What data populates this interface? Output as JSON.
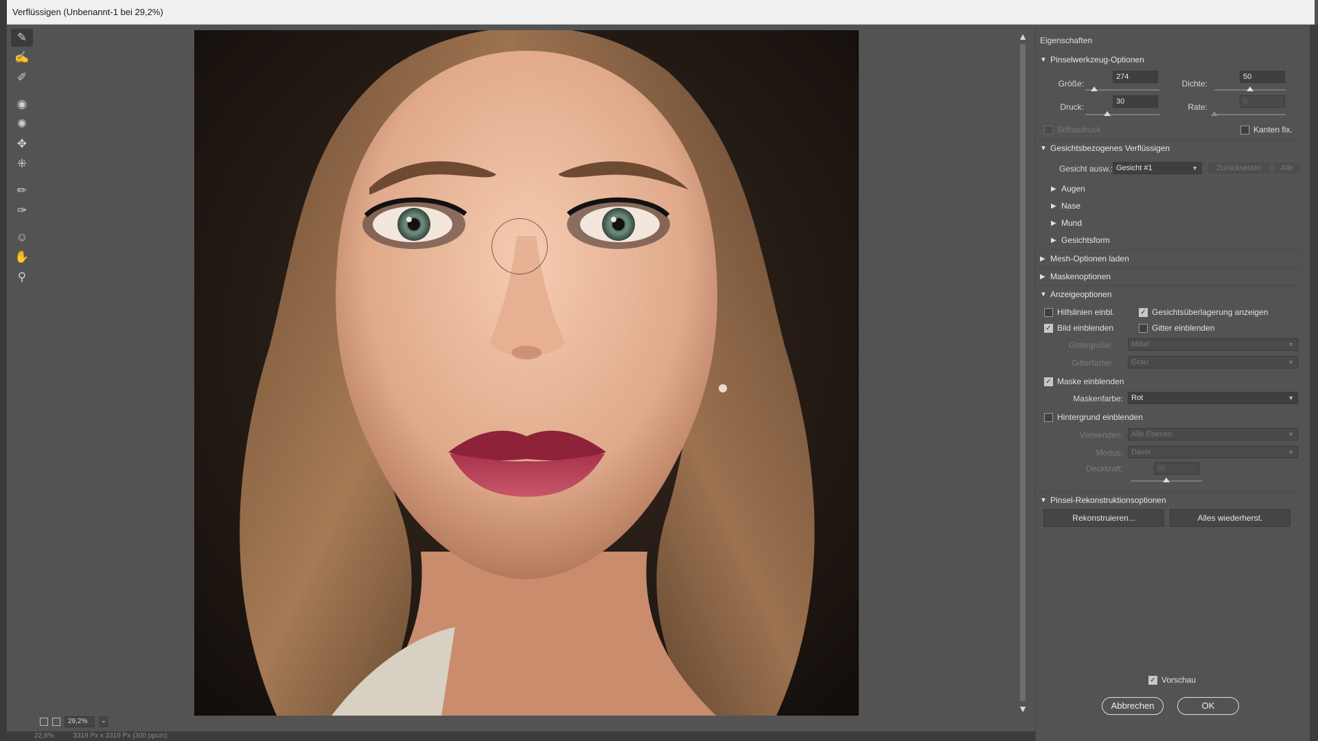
{
  "window": {
    "title": "Verflüssigen (Unbenannt-1 bei 29,2%)"
  },
  "tools": [
    {
      "name": "forward-warp-tool-icon",
      "glyph": "✎"
    },
    {
      "name": "reconstruct-tool-icon",
      "glyph": "✍"
    },
    {
      "name": "smooth-tool-icon",
      "glyph": "✐"
    },
    {
      "name": "twirl-tool-icon",
      "glyph": "◉"
    },
    {
      "name": "pucker-tool-icon",
      "glyph": "✺"
    },
    {
      "name": "bloat-tool-icon",
      "glyph": "✥"
    },
    {
      "name": "push-left-tool-icon",
      "glyph": "⁜"
    },
    {
      "name": "freeze-mask-tool-icon",
      "glyph": "✏"
    },
    {
      "name": "thaw-mask-tool-icon",
      "glyph": "✑"
    },
    {
      "name": "face-tool-icon",
      "glyph": "☺"
    },
    {
      "name": "hand-tool-icon",
      "glyph": "✋"
    },
    {
      "name": "zoom-tool-icon",
      "glyph": "⚲"
    }
  ],
  "canvas": {
    "zoom": "29,2%"
  },
  "status": {
    "zoom": "22,9%",
    "size": "3319 Px x 3319 Px (300 ppcm)"
  },
  "panel": {
    "title": "Eigenschaften",
    "brush": {
      "header": "Pinselwerkzeug-Optionen",
      "size_label": "Größe:",
      "size": "274",
      "size_fraction": 0.12,
      "density_label": "Dichte:",
      "density": "50",
      "density_fraction": 0.5,
      "pressure_label": "Druck:",
      "pressure": "30",
      "pressure_fraction": 0.3,
      "rate_label": "Rate:",
      "rate": "0",
      "rate_fraction": 0.0,
      "stylus_label": "Stiftandruck",
      "pin_edges_label": "Kanten fix."
    },
    "face": {
      "header": "Gesichtsbezogenes Verflüssigen",
      "select_label": "Gesicht ausw.:",
      "select_value": "Gesicht #1",
      "reset_label": "Zurücksetzen",
      "all_label": "Alle",
      "sub": [
        "Augen",
        "Nase",
        "Mund",
        "Gesichtsform"
      ]
    },
    "mesh_header": "Mesh-Optionen laden",
    "mask_header": "Maskenoptionen",
    "view": {
      "header": "Anzeigeoptionen",
      "guides_label": "Hilfslinien einbl.",
      "face_overlay_label": "Gesichtsüberlagerung anzeigen",
      "image_label": "Bild einblenden",
      "grid_label": "Gitter einblenden",
      "grid_size_label": "Gittergröße:",
      "grid_size_value": "Mittel",
      "grid_color_label": "Gitterfarbe:",
      "grid_color_value": "Grau",
      "mask_label": "Maske einblenden",
      "mask_color_label": "Maskenfarbe:",
      "mask_color_value": "Rot",
      "backdrop_label": "Hintergrund einblenden",
      "use_label": "Verwenden:",
      "use_value": "Alle Ebenen",
      "mode_label": "Modus:",
      "mode_value": "Davor",
      "opacity_label": "Deckkraft:",
      "opacity_value": "50",
      "opacity_fraction": 0.5
    },
    "reconstruct": {
      "header": "Pinsel-Rekonstruktionsoptionen",
      "reconstruct_label": "Rekonstruieren...",
      "restore_all_label": "Alles wiederherst."
    },
    "preview_label": "Vorschau",
    "cancel_label": "Abbrechen",
    "ok_label": "OK"
  }
}
